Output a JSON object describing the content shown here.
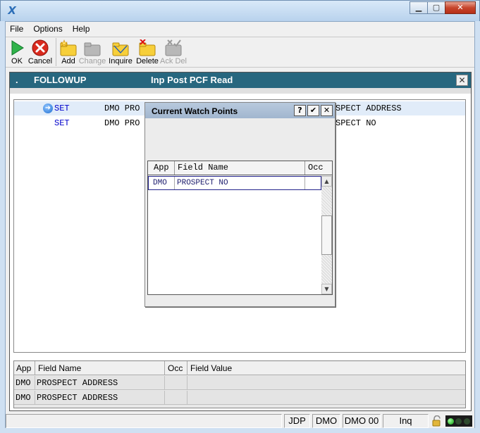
{
  "window": {
    "app_icon_glyph": "X"
  },
  "menu": [
    "File",
    "Options",
    "Help"
  ],
  "toolbar": {
    "buttons": [
      {
        "label": "OK",
        "icon": "ok-play-icon",
        "enabled": true
      },
      {
        "label": "Cancel",
        "icon": "cancel-x-icon",
        "enabled": true
      },
      {
        "label": "Add",
        "icon": "add-folder-icon",
        "enabled": true
      },
      {
        "label": "Change",
        "icon": "change-folder-icon",
        "enabled": false
      },
      {
        "label": "Inquire",
        "icon": "inquire-folder-icon",
        "enabled": true
      },
      {
        "label": "Delete",
        "icon": "delete-folder-icon",
        "enabled": true
      },
      {
        "label": "Ack Del",
        "icon": "ack-delete-icon",
        "enabled": false
      }
    ]
  },
  "child_window": {
    "marker": ".",
    "name": "FOLLOWUP",
    "subtitle": "Inp Post PCF Read",
    "close_glyph": "✕"
  },
  "trace": {
    "rows": [
      {
        "verb": "SET",
        "app": "DMO PRO",
        "field": "SPECT ADDRESS",
        "selected": true
      },
      {
        "verb": "SET",
        "app": "DMO PRO",
        "field": "SPECT NO",
        "selected": false
      }
    ]
  },
  "grid": {
    "headers": [
      "App",
      "Field Name",
      "Occ",
      "Field Value"
    ],
    "rows": [
      {
        "app": "DMO",
        "field_name": "PROSPECT ADDRESS",
        "occ": "",
        "value": ""
      },
      {
        "app": "DMO",
        "field_name": "PROSPECT ADDRESS",
        "occ": "",
        "value": ""
      }
    ]
  },
  "dialog": {
    "title": "Current Watch Points",
    "help_glyph": "?",
    "ok_glyph": "✔",
    "close_glyph": "✕",
    "headers": [
      "App",
      "Field Name",
      "Occ"
    ],
    "rows": [
      {
        "app": "DMO",
        "field_name": "PROSPECT NO",
        "occ": ""
      }
    ]
  },
  "statusbar": {
    "user": "JDP",
    "app": "DMO",
    "system": "DMO 00",
    "mode": "Inq"
  },
  "colors": {
    "child_title_bg": "#27677f",
    "trace_verb": "#0000cc",
    "selected_row": "#e1ecf9",
    "dialog_title_bg": "#a1b6cf"
  }
}
